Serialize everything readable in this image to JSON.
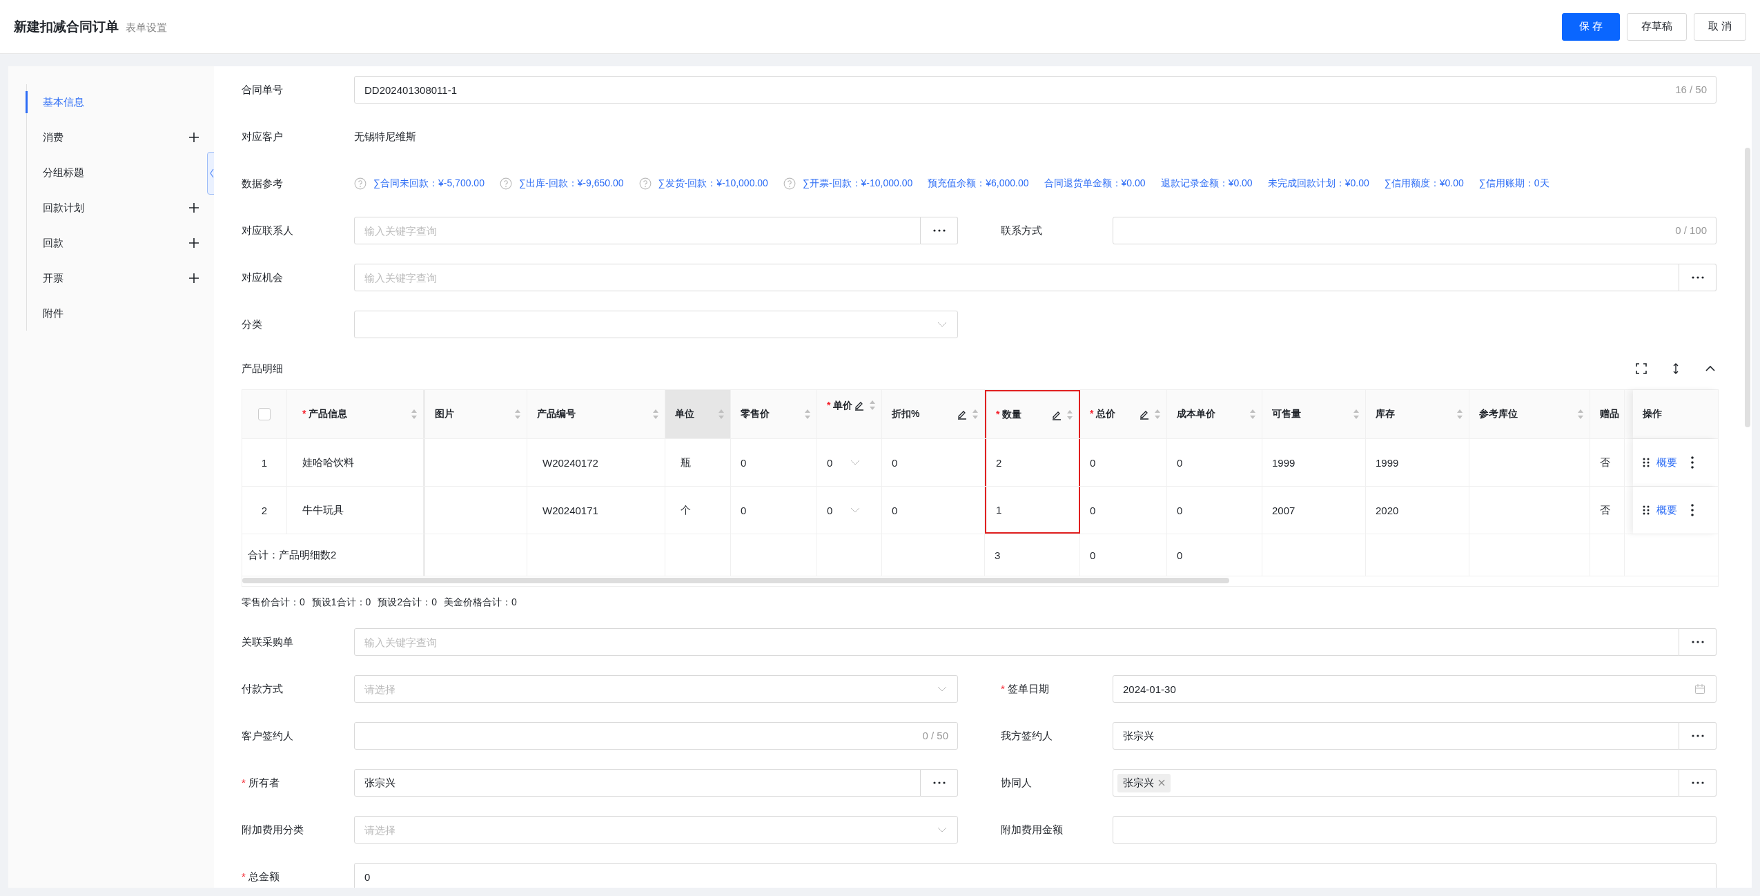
{
  "header": {
    "title": "新建扣减合同订单",
    "subtitle": "表单设置",
    "buttons": [
      {
        "label": "保 存",
        "kind": "primary"
      },
      {
        "label": "存草稿",
        "kind": "default"
      },
      {
        "label": "取 消",
        "kind": "default"
      }
    ]
  },
  "sidebar": {
    "items": [
      {
        "label": "基本信息",
        "selected": true,
        "addable": false
      },
      {
        "label": "消费",
        "selected": false,
        "addable": true
      },
      {
        "label": "分组标题",
        "selected": false,
        "addable": false
      },
      {
        "label": "回款计划",
        "selected": false,
        "addable": true
      },
      {
        "label": "回款",
        "selected": false,
        "addable": true
      },
      {
        "label": "开票",
        "selected": false,
        "addable": true
      },
      {
        "label": "附件",
        "selected": false,
        "addable": false
      }
    ]
  },
  "form_top": [
    [
      {
        "label": "合同单号",
        "kind": "text",
        "value": "DD202401308011-1",
        "counter": "16 / 50"
      }
    ],
    [
      {
        "label": "对应客户",
        "kind": "static",
        "value": "无锡特尼维斯"
      }
    ],
    [
      {
        "label": "数据参考",
        "kind": "refs",
        "items": [
          {
            "text": "∑合同未回款：¥-5,700.00",
            "help": true
          },
          {
            "text": "∑出库-回款：¥-9,650.00",
            "help": true
          },
          {
            "text": "∑发货-回款：¥-10,000.00",
            "help": true
          },
          {
            "text": "∑开票-回款：¥-10,000.00",
            "help": true
          },
          {
            "text": "预充值余额：¥6,000.00",
            "help": false
          },
          {
            "text": "合同退货单金额：¥0.00",
            "help": false
          },
          {
            "text": "退款记录金额：¥0.00",
            "help": false
          },
          {
            "text": "未完成回款计划：¥0.00",
            "help": false
          },
          {
            "text": "∑信用额度：¥0.00",
            "help": false
          },
          {
            "text": "∑信用账期：0天",
            "help": false
          }
        ]
      }
    ],
    [
      {
        "label": "对应联系人",
        "kind": "lookup",
        "placeholder": "输入关键字查询"
      },
      {
        "label": "联系方式",
        "kind": "text",
        "counter": "0 / 100"
      }
    ],
    [
      {
        "label": "对应机会",
        "kind": "lookup",
        "placeholder": "输入关键字查询"
      }
    ],
    [
      {
        "label": "分类",
        "kind": "select"
      }
    ]
  ],
  "products": {
    "title": "产品明细",
    "select_all": {
      "checked": false
    },
    "columns": [
      {
        "label": "产品信息",
        "required_mark": "*",
        "editable": false,
        "highlighted": false,
        "outlined": false,
        "kind": "text"
      },
      {
        "label": "图片",
        "editable": false,
        "highlighted": false,
        "outlined": false,
        "kind": "text"
      },
      {
        "label": "产品编号",
        "editable": false,
        "highlighted": false,
        "outlined": false,
        "kind": "text"
      },
      {
        "label": "单位",
        "editable": false,
        "highlighted": true,
        "outlined": false,
        "kind": "text"
      },
      {
        "label": "零售价",
        "editable": false,
        "highlighted": false,
        "outlined": false,
        "kind": "text"
      },
      {
        "label": "单价",
        "required_mark": "*",
        "editable": true,
        "highlighted": false,
        "outlined": false,
        "kind": "select"
      },
      {
        "label": "折扣%",
        "editable": true,
        "highlighted": false,
        "outlined": false,
        "kind": "text"
      },
      {
        "label": "数量",
        "required_mark": "*",
        "editable": true,
        "highlighted": false,
        "outlined": true,
        "kind": "text"
      },
      {
        "label": "总价",
        "required_mark": "*",
        "editable": true,
        "highlighted": false,
        "outlined": false,
        "kind": "text"
      },
      {
        "label": "成本单价",
        "editable": false,
        "highlighted": false,
        "outlined": false,
        "kind": "text"
      },
      {
        "label": "可售量",
        "editable": false,
        "highlighted": false,
        "outlined": false,
        "kind": "text"
      },
      {
        "label": "库存",
        "editable": false,
        "highlighted": false,
        "outlined": false,
        "kind": "text"
      },
      {
        "label": "参考库位",
        "editable": false,
        "highlighted": false,
        "outlined": false,
        "kind": "text"
      },
      {
        "label": "赠品",
        "editable": false,
        "highlighted": false,
        "outlined": false,
        "kind": "text"
      }
    ],
    "action_header": "操作",
    "rows": [
      {
        "index": "1",
        "cells": [
          "娃哈哈饮料",
          null,
          "W20240172",
          "瓶",
          "0",
          "0",
          "0",
          "2",
          "0",
          "0",
          "1999",
          "1999",
          null,
          "否"
        ],
        "action": "概要"
      },
      {
        "index": "2",
        "cells": [
          "牛牛玩具",
          null,
          "W20240171",
          "个",
          "0",
          "0",
          "0",
          "1",
          "0",
          "0",
          "2007",
          "2020",
          null,
          "否"
        ],
        "action": "概要"
      }
    ],
    "summary": {
      "label": "合计：产品明细数2",
      "cells": [
        null,
        null,
        null,
        null,
        null,
        null,
        "3",
        "0",
        "0",
        null,
        null,
        null,
        null
      ]
    },
    "totals": [
      "零售价合计：0",
      "预设1合计：0",
      "预设2合计：0",
      "美金价格合计：0"
    ]
  },
  "form_bottom": [
    [
      {
        "label": "关联采购单",
        "kind": "lookup",
        "placeholder": "输入关键字查询"
      }
    ],
    [
      {
        "label": "付款方式",
        "kind": "select",
        "placeholder": "请选择"
      },
      {
        "label": "签单日期",
        "kind": "date",
        "required_mark": "*",
        "value": "2024-01-30"
      }
    ],
    [
      {
        "label": "客户签约人",
        "kind": "text",
        "counter": "0 / 50"
      },
      {
        "label": "我方签约人",
        "kind": "lookup",
        "value": "张宗兴"
      }
    ],
    [
      {
        "label": "所有者",
        "kind": "lookup",
        "required_mark": "*",
        "value": "张宗兴"
      },
      {
        "label": "协同人",
        "kind": "tags",
        "tags": [
          "张宗兴"
        ]
      }
    ],
    [
      {
        "label": "附加费用分类",
        "kind": "select",
        "placeholder": "请选择"
      },
      {
        "label": "附加费用金额",
        "kind": "text"
      }
    ],
    [
      {
        "label": "总金额",
        "kind": "text",
        "required_mark": "*",
        "value": "0"
      }
    ]
  ]
}
